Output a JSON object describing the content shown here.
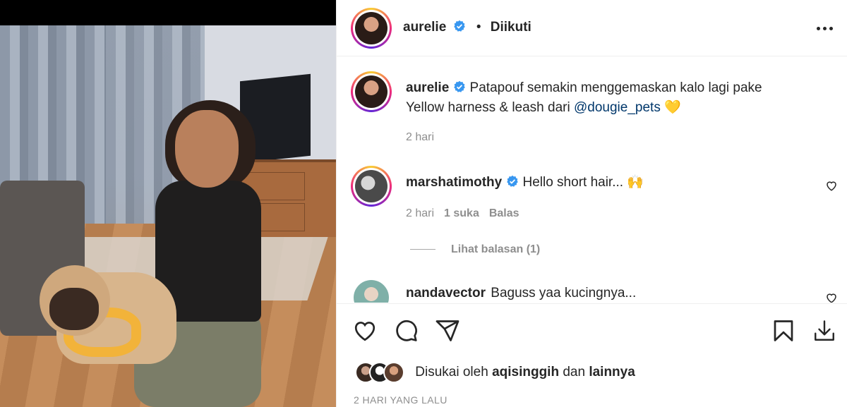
{
  "post": {
    "author": "aurelie",
    "follow_status": "Diikuti",
    "separator": "•"
  },
  "caption": {
    "username": "aurelie",
    "text": "Patapouf semakin menggemaskan kalo lagi pake Yellow harness & leash dari ",
    "mention": "@dougie_pets",
    "emoji": "💛",
    "time": "2 hari"
  },
  "comments": [
    {
      "username": "marshatimothy",
      "text": "Hello short hair... 🙌",
      "time": "2 hari",
      "likes": "1 suka",
      "reply_label": "Balas",
      "view_replies": "Lihat balasan (1)"
    },
    {
      "username": "nandavector",
      "text": "Baguss yaa kucingnya..."
    }
  ],
  "likes": {
    "prefix": "Disukai oleh",
    "user": "aqisinggih",
    "conjunction": "dan",
    "others": "lainnya"
  },
  "timestamp": "2 HARI YANG LALU",
  "icons": {
    "like": "heart-icon",
    "comment": "comment-icon",
    "share": "send-icon",
    "save": "bookmark-icon",
    "download": "download-icon",
    "more": "more-icon",
    "verified": "verified-badge-icon"
  },
  "colors": {
    "text": "#262626",
    "secondary": "#8e8e8e",
    "link": "#00376b",
    "verified": "#3897f0"
  }
}
